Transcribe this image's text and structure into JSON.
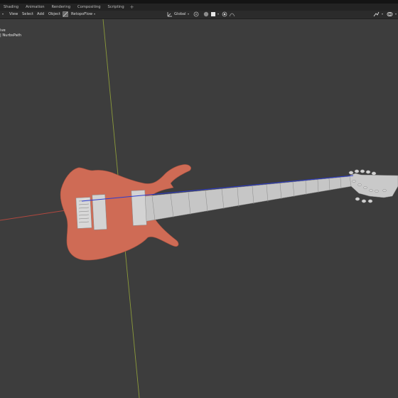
{
  "workspace_tabs": [
    "Shading",
    "Animation",
    "Rendering",
    "Compositing",
    "Scripting"
  ],
  "workspace_add": "+",
  "header": {
    "menu": [
      "View",
      "Select",
      "Add",
      "Object"
    ],
    "addon_label": "RetopoFlow",
    "transform_orientation": "Global"
  },
  "viewport": {
    "view_name": "ive",
    "object_info": "| NurbsPath"
  },
  "colors": {
    "background": "#3d3d3d",
    "guitar_body": "#cf6b55",
    "neck": "#c4c4c4",
    "x_axis": "#b0483f",
    "y_axis": "#8b9a3b",
    "curve": "#2b3bd0"
  }
}
